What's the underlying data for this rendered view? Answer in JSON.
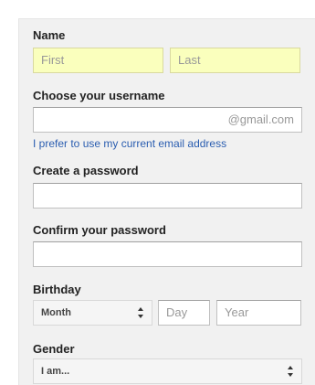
{
  "form": {
    "name": {
      "label": "Name",
      "first_placeholder": "First",
      "last_placeholder": "Last"
    },
    "username": {
      "label": "Choose your username",
      "suffix": "@gmail.com",
      "alt_link": "I prefer to use my current email address"
    },
    "password": {
      "label": "Create a password"
    },
    "confirm_password": {
      "label": "Confirm your password"
    },
    "birthday": {
      "label": "Birthday",
      "month_value": "Month",
      "day_placeholder": "Day",
      "year_placeholder": "Year"
    },
    "gender": {
      "label": "Gender",
      "value": "I am..."
    }
  },
  "colors": {
    "autofill_bg": "#faffbd",
    "link": "#2a5db0",
    "panel_bg": "#f1f1f1"
  }
}
